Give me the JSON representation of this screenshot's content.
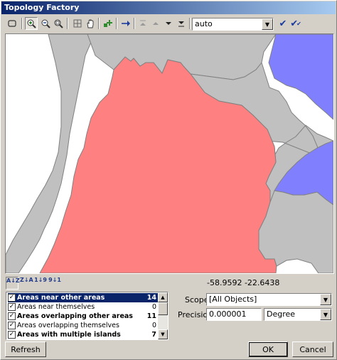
{
  "window": {
    "title": "Topology Factory"
  },
  "toolbar": {
    "zoom_level": "auto",
    "icons": [
      "select-icon",
      "zoom-in-icon",
      "zoom-out-icon",
      "zoom-extent-icon",
      "grid-icon",
      "pan-hand-icon",
      "add-node-icon",
      "arrow-right-icon",
      "first-icon",
      "previous-icon",
      "next-icon",
      "last-icon",
      "check-icon",
      "check-all-icon"
    ]
  },
  "map": {
    "colors": {
      "background": "#ffffff",
      "neighbor": "#c0c0c0",
      "selected": "#ff8080",
      "water": "#8080ff",
      "outline": "#808080"
    }
  },
  "status": {
    "coordinates": "-58.9592 -22.6438"
  },
  "sort_buttons": [
    "A↓Z",
    "Z↓A",
    "1↓9",
    "9↓1"
  ],
  "error_list": [
    {
      "label": "Areas near other areas",
      "count": "14",
      "bold": true,
      "selected": true
    },
    {
      "label": "Areas near themselves",
      "count": "0",
      "bold": false,
      "selected": false
    },
    {
      "label": "Areas overlapping other areas",
      "count": "11",
      "bold": true,
      "selected": false
    },
    {
      "label": "Areas overlapping themselves",
      "count": "0",
      "bold": false,
      "selected": false
    },
    {
      "label": "Areas with multiple islands",
      "count": "7",
      "bold": true,
      "selected": false
    }
  ],
  "scope": {
    "label": "Scope:",
    "value": "[All Objects]"
  },
  "precision": {
    "label": "Precision:",
    "value": "0.000001",
    "unit": "Degree"
  },
  "buttons": {
    "refresh": "Refresh",
    "ok": "OK",
    "cancel": "Cancel"
  }
}
